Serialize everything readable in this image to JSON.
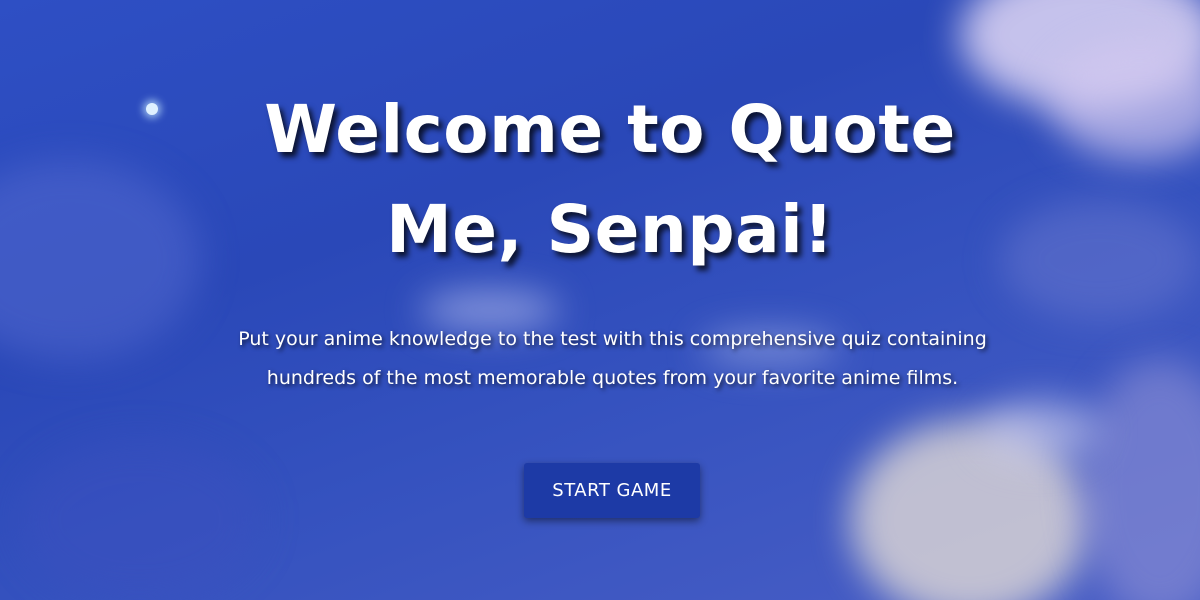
{
  "hero": {
    "title_line1": "Welcome to Quote",
    "title_line2": "Me, Senpai!",
    "description": "Put your anime knowledge to the test with this comprehensive quiz containing hundreds of the most memorable quotes from your favorite anime films.",
    "start_label": "START GAME"
  },
  "colors": {
    "sky": "#2e4fc4",
    "button": "#1d3aa6",
    "text": "#ffffff"
  }
}
